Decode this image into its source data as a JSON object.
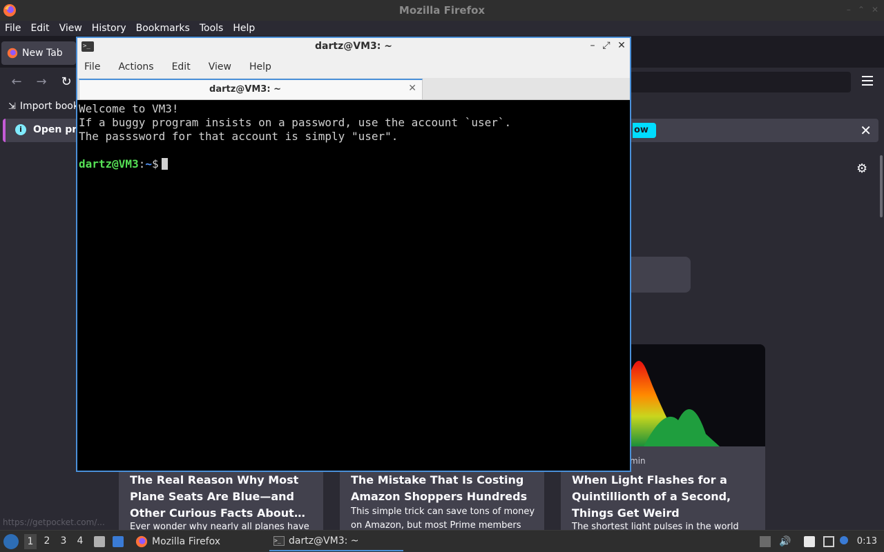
{
  "firefox": {
    "window_title": "Mozilla Firefox",
    "menu": [
      "File",
      "Edit",
      "View",
      "History",
      "Bookmarks",
      "Tools",
      "Help"
    ],
    "tab_label": "New Tab",
    "bookmark_label": "Import book",
    "notification_text": "Open pre",
    "notification_button": "ow",
    "status_url": "https://getpocket.com/...",
    "cards": [
      {
        "title": "The Real Reason Why Most Plane Seats Are Blue—and Other Curious Facts About…",
        "excerpt": "Ever wonder why nearly all planes have"
      },
      {
        "title": "The Mistake That Is Costing Amazon Shoppers Hundreds",
        "excerpt": "This simple trick can save tons of money on Amazon, but most Prime members are"
      },
      {
        "title": "When Light Flashes for a Quintillionth of a Second, Things Get Weird",
        "excerpt": "The shortest light pulses in the world",
        "meta": "min"
      }
    ]
  },
  "terminal": {
    "window_title": "dartz@VM3: ~",
    "menu": [
      "File",
      "Actions",
      "Edit",
      "View",
      "Help"
    ],
    "tab_label": "dartz@VM3: ~",
    "lines": [
      "Welcome to VM3!",
      "If a buggy program insists on a password, use the account `user`.",
      "The passsword for that account is simply \"user\"."
    ],
    "prompt_user": "dartz@VM3",
    "prompt_sep": ":",
    "prompt_path": "~",
    "prompt_symbol": "$"
  },
  "taskbar": {
    "workspaces": [
      "1",
      "2",
      "3",
      "4"
    ],
    "tasks": [
      "Mozilla Firefox",
      "dartz@VM3: ~"
    ],
    "clock": "0:13"
  },
  "colors": {
    "terminal_border": "#4a90d9",
    "prompt_user": "#55e055",
    "prompt_path": "#5599ff",
    "firefox_bg": "#2b2a33"
  }
}
